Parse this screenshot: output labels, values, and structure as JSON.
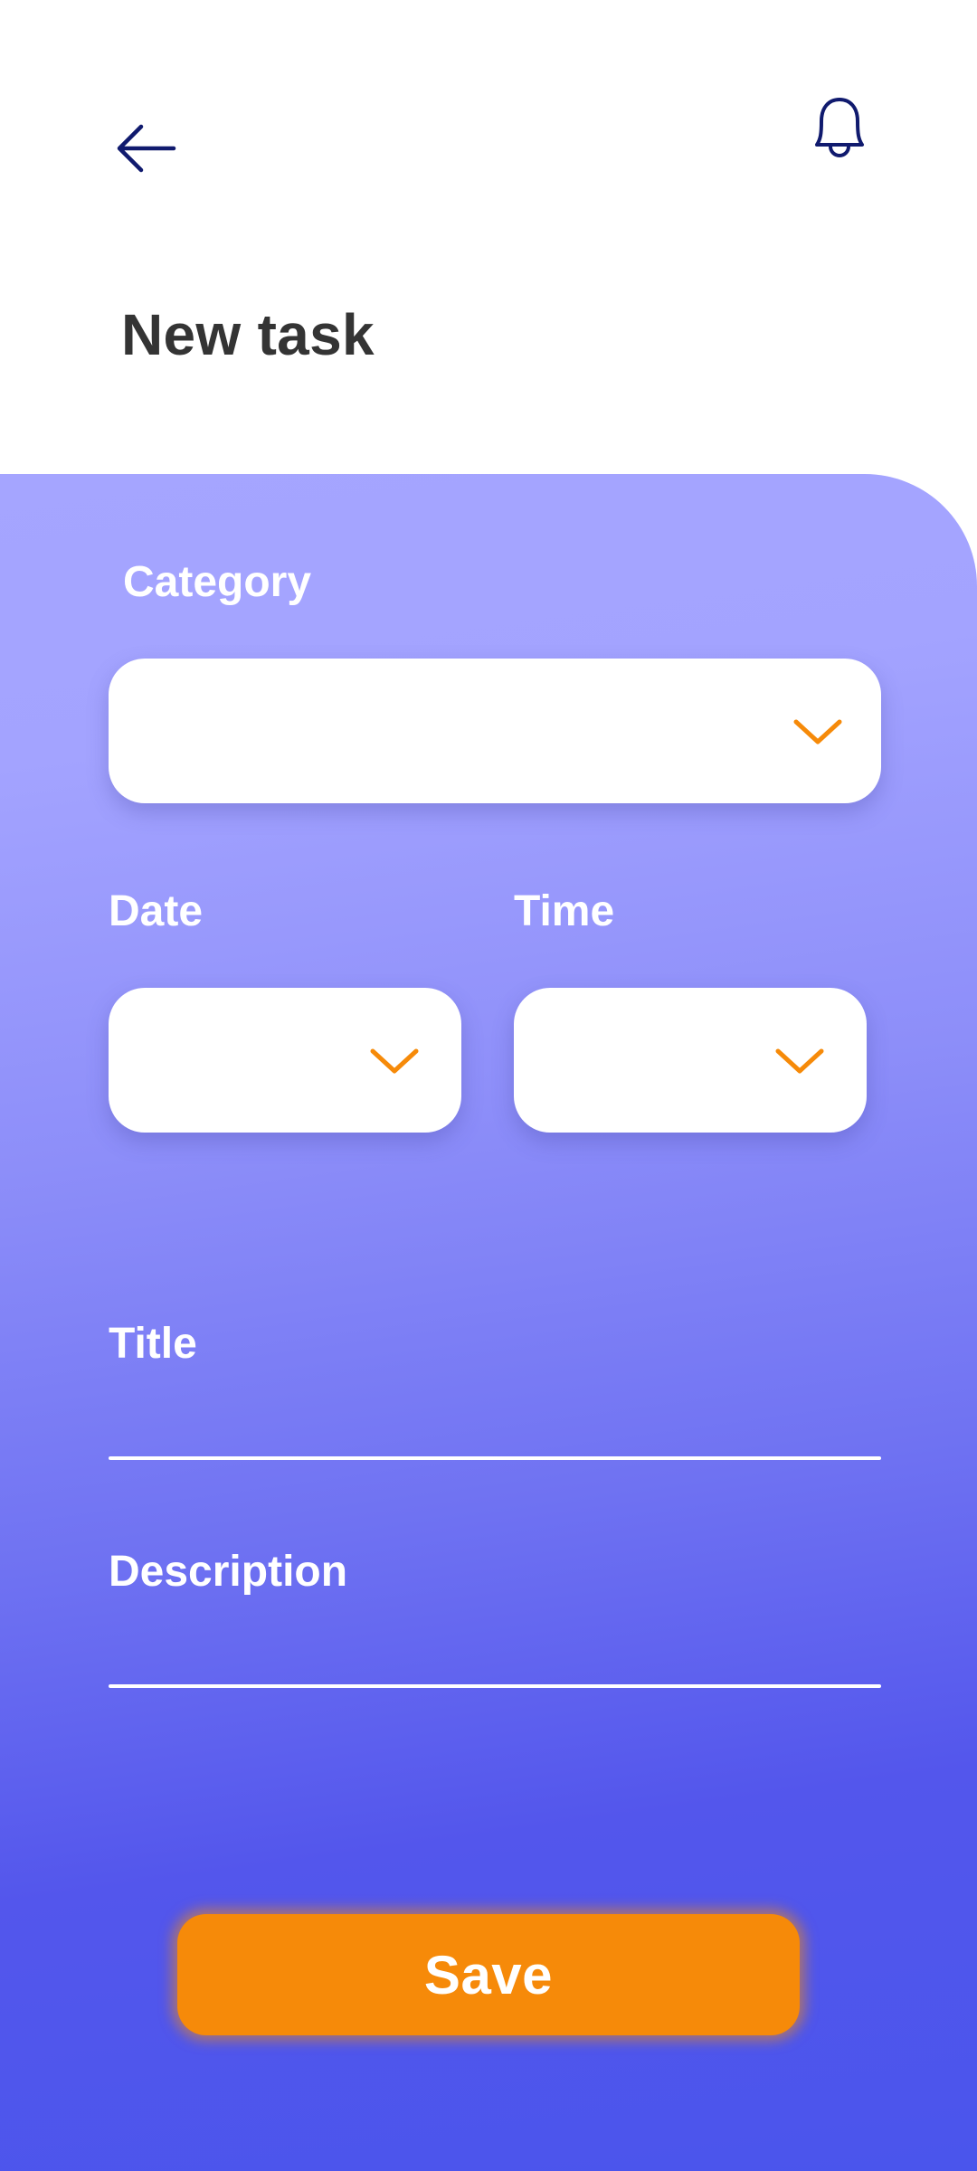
{
  "header": {
    "back_icon": "arrow-left-icon",
    "notification_icon": "bell-icon",
    "title": "New task",
    "icon_color": "#101a6e",
    "title_color": "#343434"
  },
  "form": {
    "category": {
      "label": "Category",
      "value": "",
      "icon": "chevron-down-icon"
    },
    "date": {
      "label": "Date",
      "value": "",
      "icon": "chevron-down-icon"
    },
    "time": {
      "label": "Time",
      "value": "",
      "icon": "chevron-down-icon"
    },
    "title": {
      "label": "Title",
      "value": ""
    },
    "description": {
      "label": "Description",
      "value": ""
    }
  },
  "actions": {
    "save_label": "Save"
  },
  "colors": {
    "accent": "#f68a09",
    "panel_top": "#a5a5ff",
    "panel_bottom": "#4a55ec",
    "field_bg": "#ffffff"
  }
}
